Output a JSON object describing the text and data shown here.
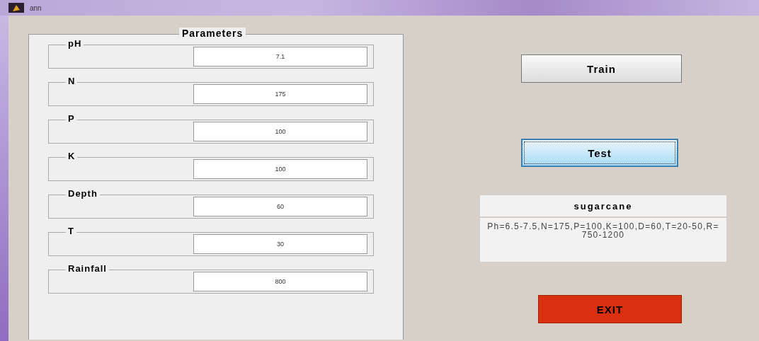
{
  "window": {
    "title": "ann"
  },
  "parameters": {
    "title": "Parameters",
    "fields": [
      {
        "label": "pH",
        "value": "7.1"
      },
      {
        "label": "N",
        "value": "175"
      },
      {
        "label": "P",
        "value": "100"
      },
      {
        "label": "K",
        "value": "100"
      },
      {
        "label": "Depth",
        "value": "60"
      },
      {
        "label": "T",
        "value": "30"
      },
      {
        "label": "Rainfall",
        "value": "800"
      }
    ]
  },
  "buttons": [
    {
      "label": "Train",
      "kind": "plain",
      "focused": false
    },
    {
      "label": "Test",
      "kind": "plain",
      "focused": true
    }
  ],
  "result": {
    "crop": "sugarcane",
    "details": "Ph=6.5-7.5,N=175,P=100,K=100,D=60,T=20-50,R=750-1200"
  },
  "exit_button": {
    "label": "EXIT",
    "kind": "danger",
    "focused": false
  }
}
